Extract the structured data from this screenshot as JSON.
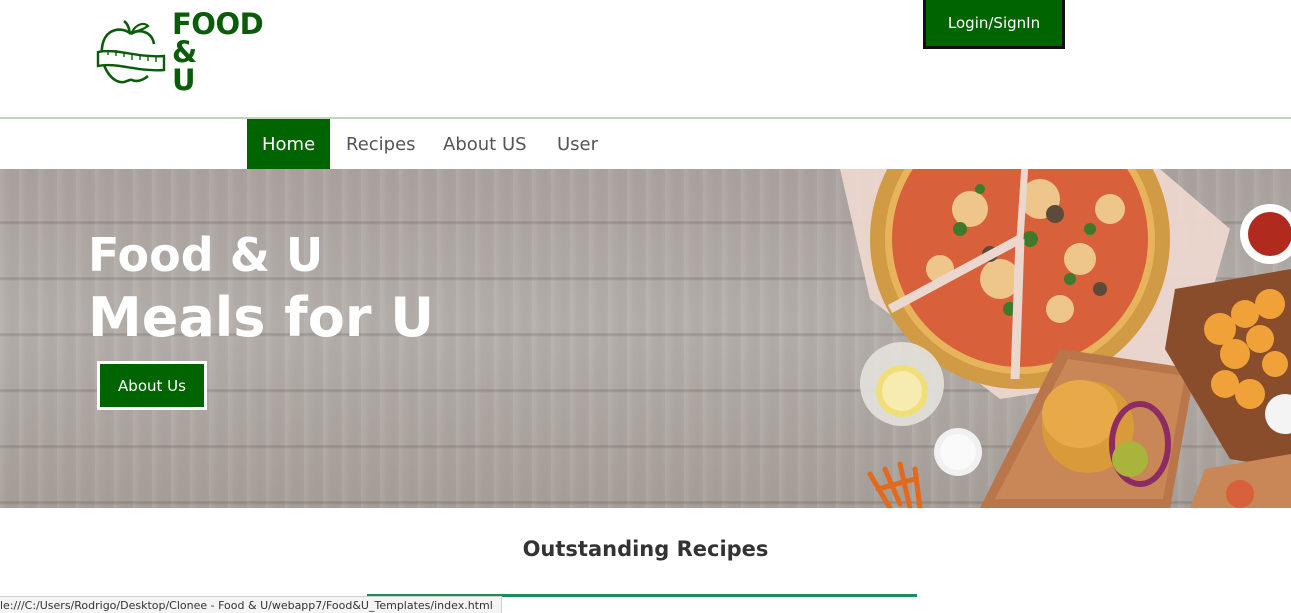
{
  "logo": {
    "line1": "FOOD",
    "line2": "&",
    "line3": "U",
    "icon": "apple-measuring-tape-icon",
    "color": "#0a5c0a"
  },
  "header": {
    "login_label": "Login/SignIn"
  },
  "nav": {
    "items": [
      {
        "label": "Home",
        "active": true
      },
      {
        "label": "Recipes",
        "active": false
      },
      {
        "label": "About US",
        "active": false
      },
      {
        "label": "User",
        "active": false
      }
    ]
  },
  "hero": {
    "title": "Food & U",
    "subtitle": "Meals for U",
    "button_label": "About Us"
  },
  "section": {
    "title": "Outstanding Recipes"
  },
  "status_bar": {
    "text": "le:///C:/Users/Rodrigo/Desktop/Clonee -  Food & U/webapp7/Food&U_Templates/index.html"
  },
  "colors": {
    "accent": "#006400",
    "section_underline": "#1e8c5a"
  }
}
